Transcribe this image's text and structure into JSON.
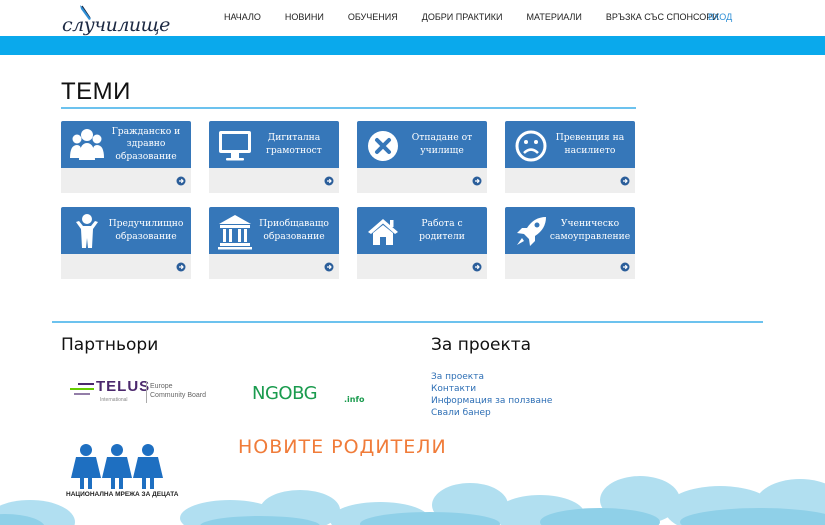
{
  "header": {
    "logo_text": "случилище",
    "nav": [
      "НАЧАЛО",
      "НОВИНИ",
      "ОБУЧЕНИЯ",
      "ДОБРИ ПРАКТИКИ",
      "МАТЕРИАЛИ",
      "ВРЪЗКА СЪС СПОНСОРИ"
    ],
    "login": "ВХОД"
  },
  "topics": {
    "title": "ТЕМИ",
    "cards": [
      {
        "label": "Гражданско и здравно образование",
        "icon": "people-group-icon"
      },
      {
        "label": "Дигитална грамотност",
        "icon": "monitor-icon"
      },
      {
        "label": "Отпадане от училище",
        "icon": "x-circle-icon"
      },
      {
        "label": "Превенция на насилието",
        "icon": "sad-face-icon"
      },
      {
        "label": "Предучилищно образование",
        "icon": "child-icon"
      },
      {
        "label": "Приобщаващо образование",
        "icon": "institution-icon"
      },
      {
        "label": "Работа с родители",
        "icon": "home-icon"
      },
      {
        "label": "Ученическо самоуправление",
        "icon": "rocket-icon"
      }
    ],
    "arrow_icon": "arrow-circle-right-icon"
  },
  "footer": {
    "partners_title": "Партньори",
    "about_title": "За проекта",
    "links": [
      "За проекта",
      "Контакти",
      "Информация за ползване",
      "Свали банер"
    ],
    "partners": {
      "telus_name": "TELUS",
      "telus_sub": "International",
      "telus_line1": "Europe",
      "telus_line2": "Community Board",
      "ngo_name": "NGOBG",
      "ngo_suffix": ".info",
      "novite": "НОВИТЕ РОДИТЕЛИ",
      "kids_caption": "НАЦИОНАЛНА МРЕЖА ЗА ДЕЦАТА"
    }
  },
  "colors": {
    "brand_blue": "#0aa9ec",
    "card_blue": "#3677b9",
    "card_footer": "#eeeeee",
    "rule": "#6cc2ee",
    "link": "#2e6fb5"
  }
}
